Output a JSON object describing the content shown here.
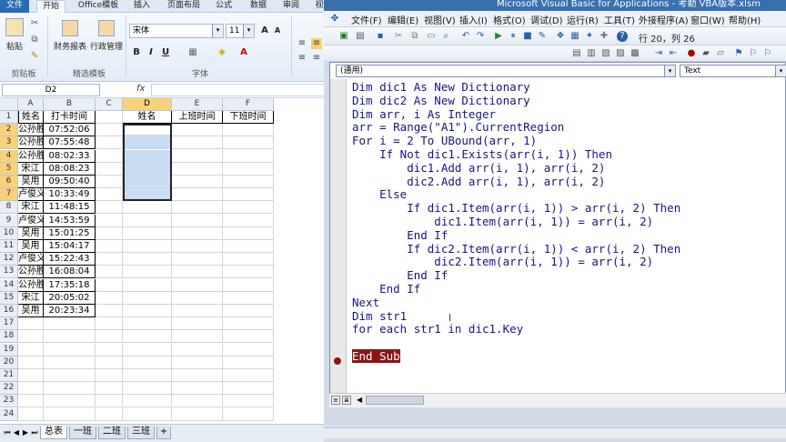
{
  "excel": {
    "tabs": [
      "文件",
      "开始",
      "Office模板",
      "插入",
      "页面布局",
      "公式",
      "数据",
      "审阅",
      "视"
    ],
    "ribbon": {
      "paste_label": "粘贴",
      "finance_label": "财务报表",
      "admin_label": "行政管理",
      "font_name": "宋体",
      "font_size": "11",
      "group_clipboard": "剪贴板",
      "group_templates": "精选模板",
      "group_font": "字体"
    },
    "name_box": "D2",
    "fx": "fx",
    "columns": [
      "A",
      "B",
      "C",
      "D",
      "E",
      "F"
    ],
    "header_row": [
      "姓名",
      "打卡时间",
      "",
      "姓名",
      "上班时间",
      "下班时间"
    ],
    "rows": [
      [
        "公孙胜",
        "07:52:06"
      ],
      [
        "公孙胜",
        "07:55:48"
      ],
      [
        "公孙胜",
        "08:02:33"
      ],
      [
        "宋江",
        "08:08:23"
      ],
      [
        "吴用",
        "09:50:40"
      ],
      [
        "卢俊义",
        "10:33:49"
      ],
      [
        "宋江",
        "11:48:15"
      ],
      [
        "卢俊义",
        "14:53:59"
      ],
      [
        "吴用",
        "15:01:25"
      ],
      [
        "吴用",
        "15:04:17"
      ],
      [
        "卢俊义",
        "15:22:43"
      ],
      [
        "公孙胜",
        "16:08:04"
      ],
      [
        "公孙胜",
        "17:35:18"
      ],
      [
        "宋江",
        "20:05:02"
      ],
      [
        "吴用",
        "20:23:34"
      ]
    ],
    "row_numbers": [
      "1",
      "2",
      "3",
      "4",
      "5",
      "6",
      "7",
      "8",
      "9",
      "10",
      "11",
      "12",
      "13",
      "14",
      "15",
      "16",
      "17",
      "18",
      "19",
      "20",
      "21",
      "22",
      "23",
      "24"
    ],
    "sheets": [
      "总表",
      "一班",
      "二班",
      "三班"
    ]
  },
  "vbe": {
    "title": "Microsoft Visual Basic for Applications - 考勤 VBA版本.xlsm",
    "menu": [
      "文件(F)",
      "编辑(E)",
      "视图(V)",
      "插入(I)",
      "格式(O)",
      "调试(D)",
      "运行(R)",
      "工具(T)",
      "外接程序(A)",
      "窗口(W)",
      "帮助(H)"
    ],
    "position": "行 20，列 26",
    "object_selector": "(通用)",
    "procedure_selector": "Text",
    "code_lines": [
      "Dim dic1 As New Dictionary",
      "Dim dic2 As New Dictionary",
      "Dim arr, i As Integer",
      "arr = Range(\"A1\").CurrentRegion",
      "For i = 2 To UBound(arr, 1)",
      "    If Not dic1.Exists(arr(i, 1)) Then",
      "        dic1.Add arr(i, 1), arr(i, 2)",
      "        dic2.Add arr(i, 1), arr(i, 2)",
      "    Else",
      "        If dic1.Item(arr(i, 1)) > arr(i, 2) Then",
      "            dic1.Item(arr(i, 1)) = arr(i, 2)",
      "        End If",
      "        If dic2.Item(arr(i, 1)) < arr(i, 2) Then",
      "            dic2.Item(arr(i, 1)) = arr(i, 2)",
      "        End If",
      "    End If",
      "Next",
      "Dim str1",
      "for each str1 in dic1.Key",
      "",
      "End Sub"
    ]
  }
}
